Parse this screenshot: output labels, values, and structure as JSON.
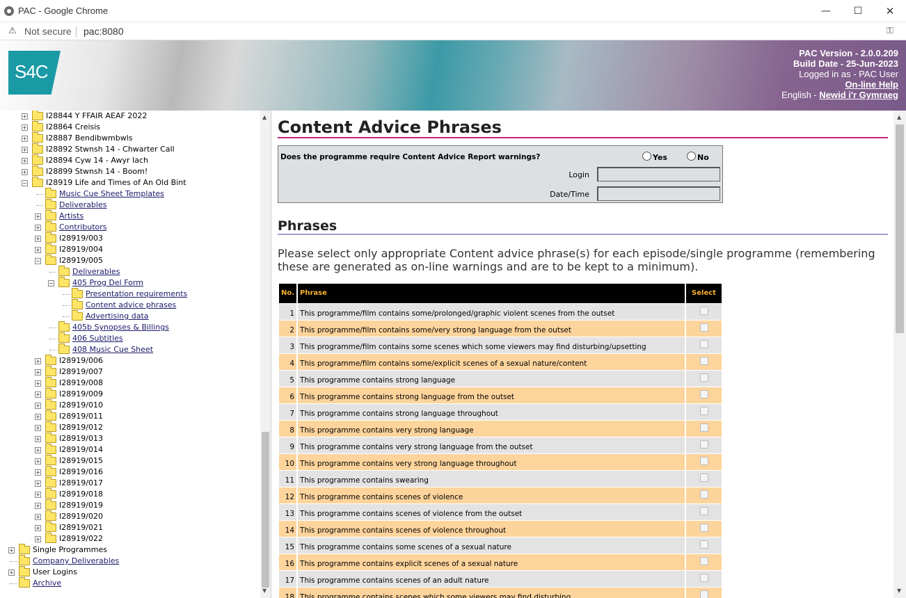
{
  "window": {
    "title": "PAC - Google Chrome",
    "minimize_glyph": "—",
    "maximize_glyph": "☐",
    "close_glyph": "✕"
  },
  "address": {
    "warning_glyph": "⚠",
    "security_label": "Not secure",
    "url": "pac:8080",
    "key_glyph": "⚿"
  },
  "header": {
    "logo_text": "S4C",
    "version": "PAC Version - 2.0.0.209",
    "build_date": "Build Date - 25-Jun-2023",
    "logged_in": "Logged in as - PAC User",
    "help_link": "On-line Help",
    "language_prefix": "English - ",
    "language_link": "Newid i'r Gymraeg"
  },
  "tree": {
    "items": [
      {
        "label": "I28844 Y FFAIR AEAF 2022",
        "level": 0,
        "expander": "+",
        "link": false
      },
      {
        "label": "I28864 Creisis",
        "level": 0,
        "expander": "+",
        "link": false
      },
      {
        "label": "I28887 Bendibwmbwls",
        "level": 0,
        "expander": "+",
        "link": false
      },
      {
        "label": "I28892 Stwnsh 14 - Chwarter Call",
        "level": 0,
        "expander": "+",
        "link": false
      },
      {
        "label": "I28894 Cyw 14 - Awyr Iach",
        "level": 0,
        "expander": "+",
        "link": false
      },
      {
        "label": "I28899 Stwnsh 14 - Boom!",
        "level": 0,
        "expander": "+",
        "link": false
      },
      {
        "label": "I28919 Life and Times of An Old Bint",
        "level": 0,
        "expander": "−",
        "link": false
      },
      {
        "label": "Music Cue Sheet Templates",
        "level": 1,
        "expander": "",
        "link": true
      },
      {
        "label": "Deliverables",
        "level": 1,
        "expander": "",
        "link": true
      },
      {
        "label": "Artists",
        "level": 1,
        "expander": "+",
        "link": true
      },
      {
        "label": "Contributors",
        "level": 1,
        "expander": "+",
        "link": true
      },
      {
        "label": "I28919/003",
        "level": 1,
        "expander": "+",
        "link": false
      },
      {
        "label": "I28919/004",
        "level": 1,
        "expander": "+",
        "link": false
      },
      {
        "label": "I28919/005",
        "level": 1,
        "expander": "−",
        "link": false
      },
      {
        "label": "Deliverables",
        "level": 2,
        "expander": "",
        "link": true
      },
      {
        "label": "405 Prog Del Form",
        "level": 2,
        "expander": "−",
        "link": true
      },
      {
        "label": "Presentation requirements",
        "level": 3,
        "expander": "",
        "link": true
      },
      {
        "label": "Content advice phrases",
        "level": 3,
        "expander": "",
        "link": true
      },
      {
        "label": "Advertising data",
        "level": 3,
        "expander": "",
        "link": true
      },
      {
        "label": "405b Synopses & Billings",
        "level": 2,
        "expander": "",
        "link": true
      },
      {
        "label": "406 Subtitles",
        "level": 2,
        "expander": "",
        "link": true
      },
      {
        "label": "408 Music Cue Sheet",
        "level": 2,
        "expander": "",
        "link": true
      },
      {
        "label": "I28919/006",
        "level": 1,
        "expander": "+",
        "link": false
      },
      {
        "label": "I28919/007",
        "level": 1,
        "expander": "+",
        "link": false
      },
      {
        "label": "I28919/008",
        "level": 1,
        "expander": "+",
        "link": false
      },
      {
        "label": "I28919/009",
        "level": 1,
        "expander": "+",
        "link": false
      },
      {
        "label": "I28919/010",
        "level": 1,
        "expander": "+",
        "link": false
      },
      {
        "label": "I28919/011",
        "level": 1,
        "expander": "+",
        "link": false
      },
      {
        "label": "I28919/012",
        "level": 1,
        "expander": "+",
        "link": false
      },
      {
        "label": "I28919/013",
        "level": 1,
        "expander": "+",
        "link": false
      },
      {
        "label": "I28919/014",
        "level": 1,
        "expander": "+",
        "link": false
      },
      {
        "label": "I28919/015",
        "level": 1,
        "expander": "+",
        "link": false
      },
      {
        "label": "I28919/016",
        "level": 1,
        "expander": "+",
        "link": false
      },
      {
        "label": "I28919/017",
        "level": 1,
        "expander": "+",
        "link": false
      },
      {
        "label": "I28919/018",
        "level": 1,
        "expander": "+",
        "link": false
      },
      {
        "label": "I28919/019",
        "level": 1,
        "expander": "+",
        "link": false
      },
      {
        "label": "I28919/020",
        "level": 1,
        "expander": "+",
        "link": false
      },
      {
        "label": "I28919/021",
        "level": 1,
        "expander": "+",
        "link": false
      },
      {
        "label": "I28919/022",
        "level": 1,
        "expander": "+",
        "link": false
      },
      {
        "label": "Single Programmes",
        "level": -1,
        "expander": "+",
        "link": false
      },
      {
        "label": "Company Deliverables",
        "level": -1,
        "expander": "",
        "link": true
      },
      {
        "label": "User Logins",
        "level": -1,
        "expander": "+",
        "link": false
      },
      {
        "label": "Archive",
        "level": -1,
        "expander": "",
        "link": true
      }
    ]
  },
  "main": {
    "title": "Content Advice Phrases",
    "question": "Does the programme require Content Advice Report warnings?",
    "yes_label": "Yes",
    "no_label": "No",
    "login_label": "Login",
    "datetime_label": "Date/Time",
    "login_value": "",
    "datetime_value": "",
    "phrases_heading": "Phrases",
    "intro": "Please select only appropriate Content advice phrase(s) for each episode/single programme (remembering these are generated as on-line warnings and are to be kept to a minimum).",
    "table": {
      "col_no": "No.",
      "col_phrase": "Phrase",
      "col_select": "Select",
      "rows": [
        {
          "no": "1",
          "phrase": "This programme/film contains some/prolonged/graphic violent scenes from the outset"
        },
        {
          "no": "2",
          "phrase": "This programme/film contains some/very strong language from the outset"
        },
        {
          "no": "3",
          "phrase": "This programme/film contains some scenes which some viewers may find disturbing/upsetting"
        },
        {
          "no": "4",
          "phrase": "This programme/film contains some/explicit scenes of a sexual nature/content"
        },
        {
          "no": "5",
          "phrase": "This programme contains strong language"
        },
        {
          "no": "6",
          "phrase": "This programme contains strong language from the outset"
        },
        {
          "no": "7",
          "phrase": "This programme contains strong language throughout"
        },
        {
          "no": "8",
          "phrase": "This programme contains very strong language"
        },
        {
          "no": "9",
          "phrase": "This programme contains very strong language from the outset"
        },
        {
          "no": "10",
          "phrase": "This programme contains very strong language throughout"
        },
        {
          "no": "11",
          "phrase": "This programme contains swearing"
        },
        {
          "no": "12",
          "phrase": "This programme contains scenes of violence"
        },
        {
          "no": "13",
          "phrase": "This programme contains scenes of violence from the outset"
        },
        {
          "no": "14",
          "phrase": "This programme contains scenes of violence throughout"
        },
        {
          "no": "15",
          "phrase": "This programme contains some scenes of a sexual nature"
        },
        {
          "no": "16",
          "phrase": "This programme contains explicit scenes of a sexual nature"
        },
        {
          "no": "17",
          "phrase": "This programme contains scenes of an adult nature"
        },
        {
          "no": "18",
          "phrase": "This programme contains scenes which some viewers may find disturbing"
        }
      ]
    }
  }
}
